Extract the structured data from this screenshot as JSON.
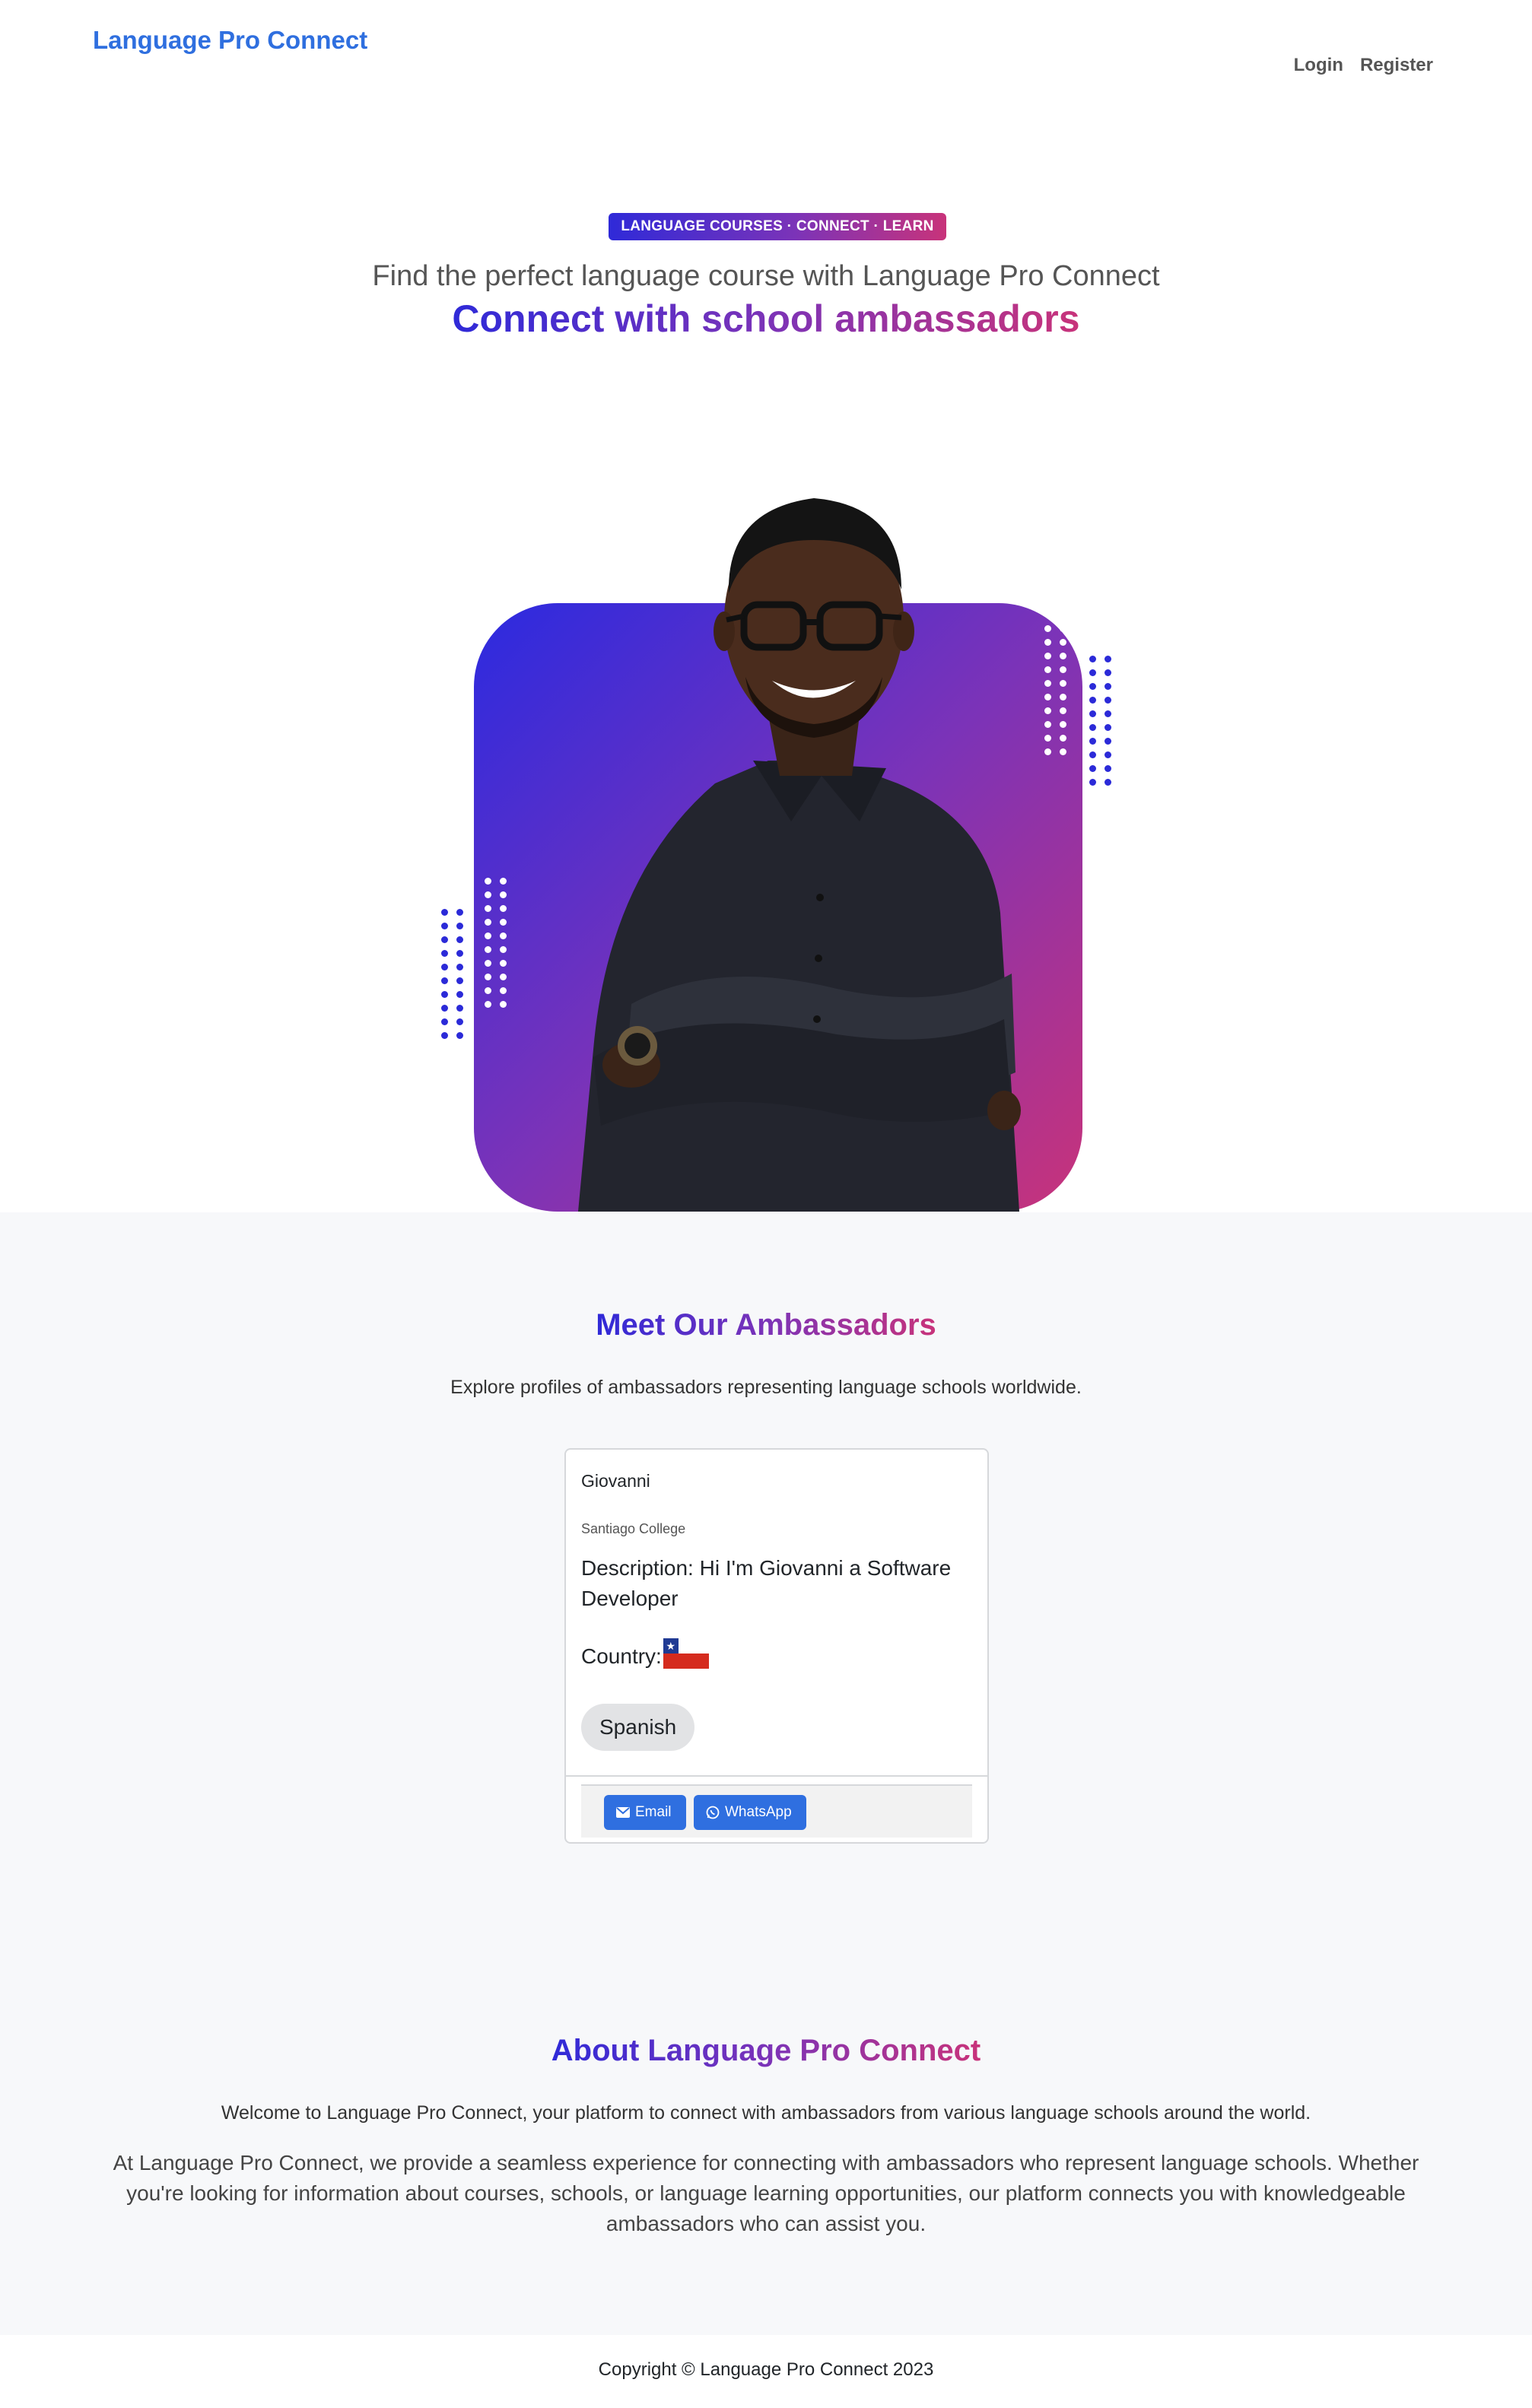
{
  "nav": {
    "brand": "Language Pro Connect",
    "links": [
      "Login",
      "Register"
    ]
  },
  "hero": {
    "badge": "LANGUAGE COURSES · CONNECT · LEARN",
    "subtitle": "Find the perfect language course with Language Pro Connect",
    "title": "Connect with school ambassadors"
  },
  "ambassadors": {
    "title": "Meet Our Ambassadors",
    "subtitle": "Explore profiles of ambassadors representing language schools worldwide.",
    "cards": [
      {
        "name": "Giovanni",
        "school": "Santiago College",
        "description": "Description: Hi I'm Giovanni a Software Developer",
        "country_label": "Country:",
        "country_flag_icon": "chile-flag",
        "language": "Spanish",
        "email_label": "Email",
        "whatsapp_label": "WhatsApp"
      }
    ]
  },
  "about": {
    "title": "About Language Pro Connect",
    "intro": "Welcome to Language Pro Connect, your platform to connect with ambassadors from various language schools around the world.",
    "body": "At Language Pro Connect, we provide a seamless experience for connecting with ambassadors who represent language schools. Whether you're looking for information about courses, schools, or language learning opportunities, our platform connects you with knowledgeable ambassadors who can assist you."
  },
  "footer": {
    "copyright": "Copyright © Language Pro Connect 2023"
  },
  "colors": {
    "brand_blue": "#2f6fdf",
    "gradient_start": "#2f2ad8",
    "gradient_mid": "#7b33b8",
    "gradient_end": "#c8337a",
    "button_blue": "#2f6fe0",
    "section_bg": "#f7f8fa"
  }
}
